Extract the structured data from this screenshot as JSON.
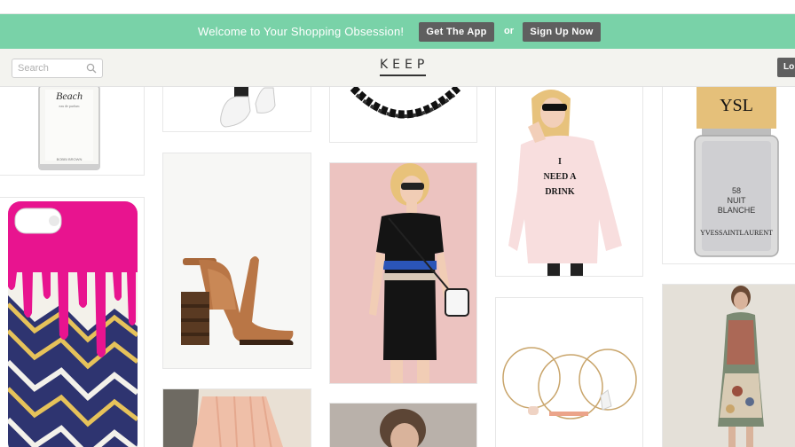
{
  "banner": {
    "welcome": "Welcome to Your Shopping Obsession!",
    "get_app_label": "Get The App",
    "or_label": "or",
    "sign_up_label": "Sign Up Now",
    "color": "#79d2a8"
  },
  "header": {
    "search_placeholder": "Search",
    "logo": "KEEP",
    "login_label": "Lo"
  },
  "products": {
    "perfume_name": "Beach",
    "perfume_sub": "eau de parfum",
    "perfume_brand": "BOBBI BROWN",
    "sweater_text_1": "I",
    "sweater_text_2": "NEED A",
    "sweater_text_3": "DRINK",
    "polish_number": "58",
    "polish_name_1": "NUIT",
    "polish_name_2": "BLANCHE",
    "polish_brand": "YVESSAINTLAURENT",
    "polish_logo": "YSL"
  }
}
